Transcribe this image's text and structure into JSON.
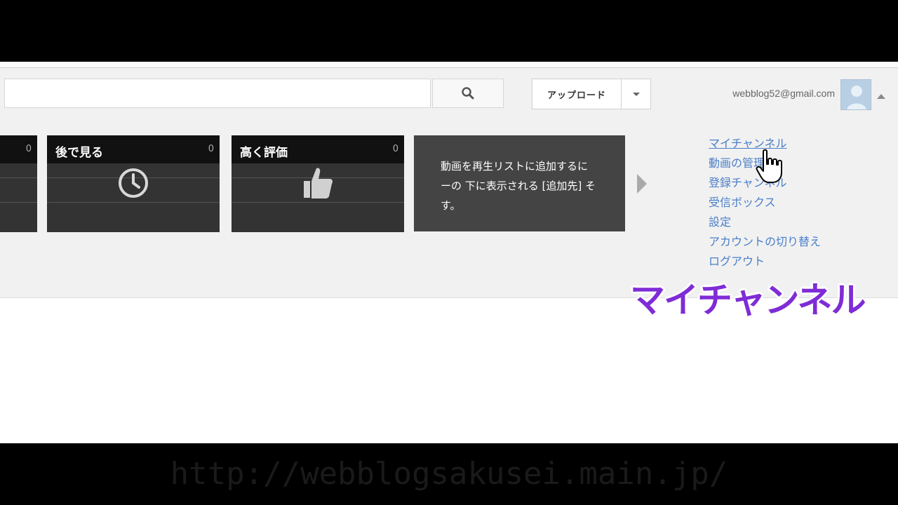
{
  "header": {
    "search": {
      "value": "",
      "placeholder": ""
    },
    "upload_label": "アップロード",
    "user_email": "webblog52@gmail.com"
  },
  "guide": {
    "tiles": [
      {
        "title": "",
        "count": "0",
        "icon": "thumb-icon"
      },
      {
        "title": "後で見る",
        "count": "0",
        "icon": "clock-icon"
      },
      {
        "title": "高く評価",
        "count": "0",
        "icon": "thumbs-up-icon"
      }
    ],
    "info_text": "動画を再生リストに追加するに\nーの 下に表示される [追加先] そ\nす。"
  },
  "account_menu": {
    "items": [
      "マイチャンネル",
      "動画の管理",
      "登録チャンネル",
      "受信ボックス",
      "設定",
      "アカウントの切り替え",
      "ログアウト"
    ]
  },
  "caption": "マイチャンネル",
  "watermark": "http://webblogsakusei.main.jp/",
  "colors": {
    "link": "#4a7fc8",
    "caption": "#7f2cd6",
    "tile_bg": "#333333"
  }
}
